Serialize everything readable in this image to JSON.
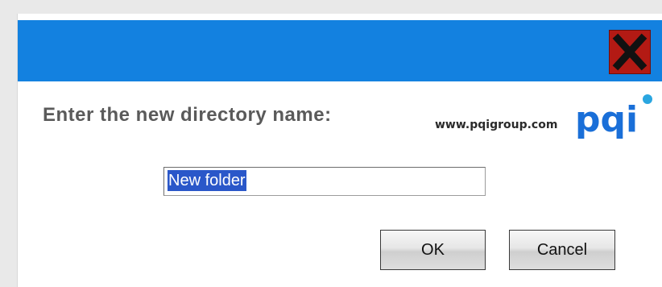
{
  "dialog": {
    "prompt": "Enter the new directory name:",
    "brand_url": "www.pqigroup.com",
    "logo_text": "pqi",
    "input_value": "New folder",
    "ok_label": "OK",
    "cancel_label": "Cancel",
    "close_icon": "close-x-icon"
  },
  "colors": {
    "titlebar": "#1381e0",
    "close_button": "#b31a14",
    "logo_blue": "#1a6fd8",
    "logo_dot": "#2aa6e0",
    "selection": "#2a57c9"
  }
}
